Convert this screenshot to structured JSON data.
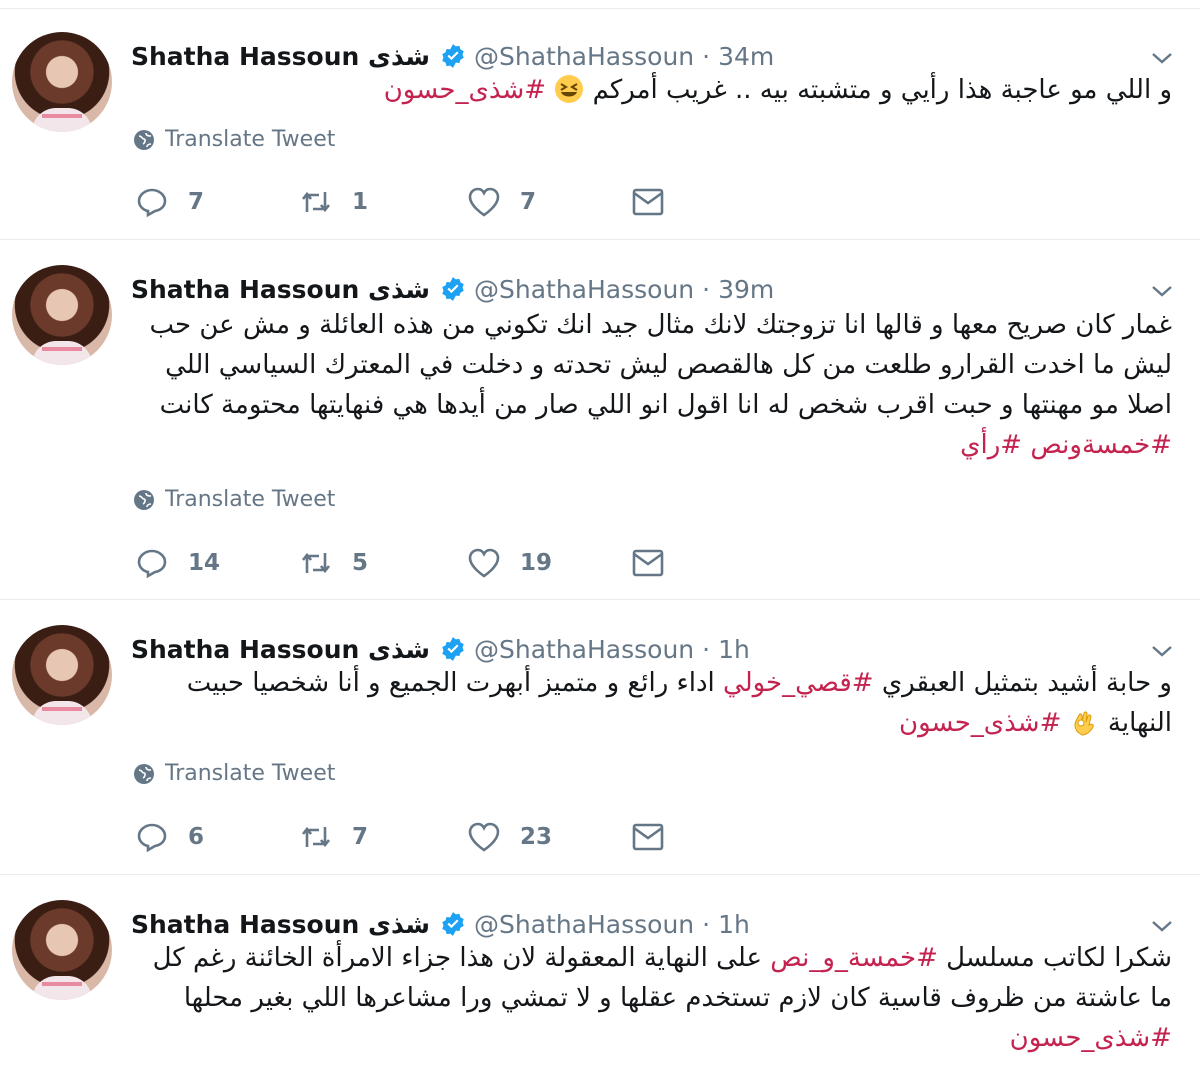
{
  "colors": {
    "hashtag": "#c4234f",
    "verified": "#1da1f2",
    "muted": "#657786"
  },
  "icons": {
    "reply": "reply-icon",
    "retweet": "retweet-icon",
    "like": "heart-icon",
    "dm": "envelope-icon",
    "translate": "globe-icon",
    "verified": "verified-badge-icon",
    "menu": "chevron-down-icon"
  },
  "tweets": [
    {
      "name": "Shatha Hassoun شذى",
      "handle": "@ShathaHassoun",
      "dot": "·",
      "time": "34m",
      "text": "و اللي مو عاجبة هذا رأيي و متشبته بيه .. غريب أمركم ",
      "emoji": "grinning-squinting-face",
      "hashtags": "#شذى_حسون",
      "translate": "Translate Tweet",
      "replies": "7",
      "retweets": "1",
      "likes": "7"
    },
    {
      "name": "Shatha Hassoun شذى",
      "handle": "@ShathaHassoun",
      "dot": "·",
      "time": "39m",
      "text": "غمار كان صريح معها و قالها انا تزوجتك لانك مثال جيد انك تكوني من هذه العائلة و مش عن حب ليش ما اخدت القرارو  طلعت من كل هالقصص ليش تحدته و دخلت في المعترك السياسي اللي اصلا مو مهنتها و حبت اقرب شخص له انا اقول انو اللي صار من أيدها هي فنهايتها محتومة كانت ",
      "hashtags": "#خمسةونص #رأي",
      "translate": "Translate Tweet",
      "replies": "14",
      "retweets": "5",
      "likes": "19"
    },
    {
      "name": "Shatha Hassoun شذى",
      "handle": "@ShathaHassoun",
      "dot": "·",
      "time": "1h",
      "text_a": "و حابة أشيد بتمثيل العبقري ",
      "hashtag_a": "#قصي_خولي",
      "text_b": " اداء رائع و متميز أبهرت الجميع و أنا شخصيا حبيت النهاية ",
      "emoji": "ok-hand",
      "hashtag_b": "#شذى_حسون",
      "translate": "Translate Tweet",
      "replies": "6",
      "retweets": "7",
      "likes": "23"
    },
    {
      "name": "Shatha Hassoun شذى",
      "handle": "@ShathaHassoun",
      "dot": "·",
      "time": "1h",
      "text_a": "شكرا لكاتب مسلسل ",
      "hashtag_a": "#خمسة_و_نص",
      "text_b": " على النهاية المعقولة لان هذا جزاء الامرأة الخائنة رغم كل ما عاشتة من ظروف قاسية كان لازم تستخدم عقلها و لا تمشي ورا مشاعرها اللي بغير محلها ",
      "hashtag_b": "#شذى_حسون"
    }
  ]
}
